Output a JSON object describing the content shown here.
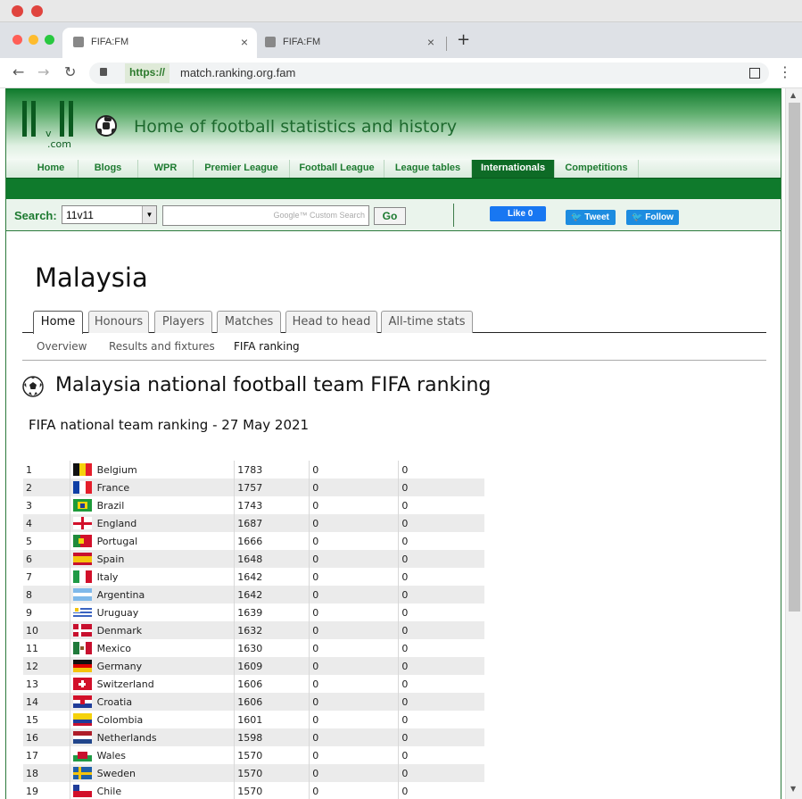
{
  "browser": {
    "tabs": [
      {
        "label": "FIFA:FM"
      },
      {
        "label": "FIFA:FM"
      }
    ],
    "new_tab": "+",
    "close": "×",
    "url_scheme": "https://",
    "url": "match.ranking.org.fam"
  },
  "site": {
    "logo_top": "11v11",
    "logo_v": "v",
    "logo_com": ".com",
    "tagline": "Home of football statistics and history",
    "nav": [
      "Home",
      "Blogs",
      "WPR",
      "Premier League",
      "Football League",
      "League tables",
      "Internationals",
      "Competitions"
    ],
    "nav_active": "Internationals",
    "search_label": "Search:",
    "search_select": "11v11",
    "search_placeholder": "Google™ Custom Search",
    "go_label": "Go",
    "like_label": "Like 0",
    "tweet_label": "Tweet",
    "follow_label": "Follow"
  },
  "page": {
    "country": "Malaysia",
    "tabs": [
      "Home",
      "Honours",
      "Players",
      "Matches",
      "Head to head",
      "All-time stats"
    ],
    "active_tab": "Home",
    "subtabs": [
      "Overview",
      "Results and fixtures",
      "FIFA ranking"
    ],
    "active_subtab": "FIFA ranking",
    "section_title": "Malaysia national football team FIFA ranking",
    "subtitle": "FIFA national team ranking - 27 May 2021"
  },
  "ranking": [
    {
      "rank": "1",
      "team": "Belgium",
      "points": "1783",
      "a": "0",
      "b": "0",
      "flag": "belgium"
    },
    {
      "rank": "2",
      "team": "France",
      "points": "1757",
      "a": "0",
      "b": "0",
      "flag": "france"
    },
    {
      "rank": "3",
      "team": "Brazil",
      "points": "1743",
      "a": "0",
      "b": "0",
      "flag": "brazil"
    },
    {
      "rank": "4",
      "team": "England",
      "points": "1687",
      "a": "0",
      "b": "0",
      "flag": "england"
    },
    {
      "rank": "5",
      "team": "Portugal",
      "points": "1666",
      "a": "0",
      "b": "0",
      "flag": "portugal"
    },
    {
      "rank": "6",
      "team": "Spain",
      "points": "1648",
      "a": "0",
      "b": "0",
      "flag": "spain"
    },
    {
      "rank": "7",
      "team": "Italy",
      "points": "1642",
      "a": "0",
      "b": "0",
      "flag": "italy"
    },
    {
      "rank": "8",
      "team": "Argentina",
      "points": "1642",
      "a": "0",
      "b": "0",
      "flag": "argentina"
    },
    {
      "rank": "9",
      "team": "Uruguay",
      "points": "1639",
      "a": "0",
      "b": "0",
      "flag": "uruguay"
    },
    {
      "rank": "10",
      "team": "Denmark",
      "points": "1632",
      "a": "0",
      "b": "0",
      "flag": "denmark"
    },
    {
      "rank": "11",
      "team": "Mexico",
      "points": "1630",
      "a": "0",
      "b": "0",
      "flag": "mexico"
    },
    {
      "rank": "12",
      "team": "Germany",
      "points": "1609",
      "a": "0",
      "b": "0",
      "flag": "germany"
    },
    {
      "rank": "13",
      "team": "Switzerland",
      "points": "1606",
      "a": "0",
      "b": "0",
      "flag": "switzerland"
    },
    {
      "rank": "14",
      "team": "Croatia",
      "points": "1606",
      "a": "0",
      "b": "0",
      "flag": "croatia"
    },
    {
      "rank": "15",
      "team": "Colombia",
      "points": "1601",
      "a": "0",
      "b": "0",
      "flag": "colombia"
    },
    {
      "rank": "16",
      "team": "Netherlands",
      "points": "1598",
      "a": "0",
      "b": "0",
      "flag": "netherlands"
    },
    {
      "rank": "17",
      "team": "Wales",
      "points": "1570",
      "a": "0",
      "b": "0",
      "flag": "wales"
    },
    {
      "rank": "18",
      "team": "Sweden",
      "points": "1570",
      "a": "0",
      "b": "0",
      "flag": "sweden"
    },
    {
      "rank": "19",
      "team": "Chile",
      "points": "1570",
      "a": "0",
      "b": "0",
      "flag": "chile"
    }
  ],
  "colors": {
    "brand_green": "#0f7a2c",
    "nav_text": "#1d7a30",
    "twitter": "#1d8ce0",
    "facebook": "#1877f2"
  }
}
